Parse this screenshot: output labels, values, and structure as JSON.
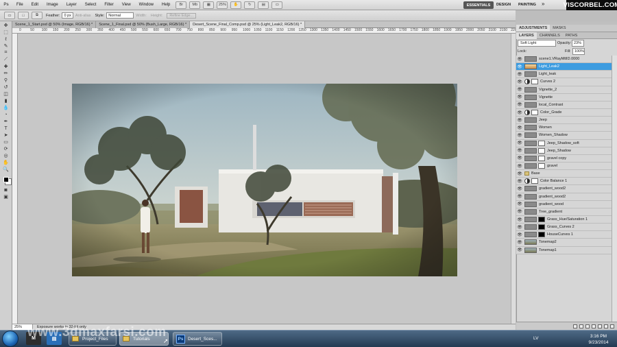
{
  "app": {
    "logo": "Ps"
  },
  "menu": [
    "File",
    "Edit",
    "Image",
    "Layer",
    "Select",
    "Filter",
    "View",
    "Window",
    "Help"
  ],
  "topbar": {
    "zoom": "25%",
    "workspaces": [
      "ESSENTIALS",
      "DESIGN",
      "PAINTING"
    ],
    "more": "»",
    "brand": "VISCORBEL.COM"
  },
  "options": {
    "feather_label": "Feather:",
    "feather_value": "0 px",
    "antialias": "Anti-alias",
    "style_label": "Style:",
    "style_value": "Normal",
    "width_label": "Width:",
    "height_label": "Height:",
    "refine_edge": "Refine Edge..."
  },
  "doc_tabs": [
    "Scene_1_Start.psd @ 50% (Image, RGB/16) *",
    "Scene_1_Final.psd @ 50% (Bush_Large, RGB/16) *",
    "Desert_Scene_Final_Comp.psd @ 25% (Light_Leak2, RGB/16) *"
  ],
  "ruler_labels": [
    "0",
    "50",
    "100",
    "150",
    "200",
    "250",
    "300",
    "350",
    "400",
    "450",
    "500",
    "550",
    "600",
    "650",
    "700",
    "750",
    "800",
    "850",
    "900",
    "950",
    "1000",
    "1050",
    "1100",
    "1150",
    "1200",
    "1250",
    "1300",
    "1350",
    "1400",
    "1450",
    "1500",
    "1550",
    "1600",
    "1650",
    "1700",
    "1750",
    "1800",
    "1850",
    "1900",
    "1950",
    "2000",
    "2050",
    "2100",
    "2150",
    "2200"
  ],
  "status": {
    "zoom": "25%",
    "text": "Exposure works in 32-bit only"
  },
  "panels": {
    "top_tabs": [
      "ADJUSTMENTS",
      "MASKS"
    ],
    "layer_tabs": [
      "LAYERS",
      "CHANNELS",
      "PATHS"
    ],
    "blend_mode": "Soft Light",
    "opacity_label": "Opacity:",
    "opacity": "23%",
    "lock_label": "Lock:",
    "fill_label": "Fill:",
    "fill": "100%"
  },
  "layers": [
    {
      "name": "scene1.VRayMtlID.0000",
      "kind": "image"
    },
    {
      "name": "Light_Leak2",
      "kind": "image",
      "selected": true
    },
    {
      "name": "Light_leak",
      "kind": "image"
    },
    {
      "name": "Curves 2",
      "kind": "adjust"
    },
    {
      "name": "Vignette_2",
      "kind": "image"
    },
    {
      "name": "Vignette",
      "kind": "image"
    },
    {
      "name": "local_Contrast",
      "kind": "image"
    },
    {
      "name": "Color_Grade",
      "kind": "adjust"
    },
    {
      "name": "Jeep",
      "kind": "image"
    },
    {
      "name": "Women",
      "kind": "image"
    },
    {
      "name": "Women_Shadow",
      "kind": "image"
    },
    {
      "name": "Jeep_Shadow_soft",
      "kind": "mask"
    },
    {
      "name": "Jeep_Shadow",
      "kind": "mask"
    },
    {
      "name": "gravel copy",
      "kind": "mask"
    },
    {
      "name": "gravel",
      "kind": "mask"
    },
    {
      "name": "Base",
      "kind": "group"
    },
    {
      "name": "Color Balance 1",
      "kind": "adjust"
    },
    {
      "name": "gradient_wood2",
      "kind": "image"
    },
    {
      "name": "gradient_wood2",
      "kind": "image"
    },
    {
      "name": "gradient_wood",
      "kind": "image"
    },
    {
      "name": "Tree_gradient",
      "kind": "image"
    },
    {
      "name": "Grass_Hue/Saturation 1",
      "kind": "blackmask"
    },
    {
      "name": "Grass_Curves 2",
      "kind": "blackmask"
    },
    {
      "name": "HouseCurves 1",
      "kind": "blackmask"
    },
    {
      "name": "Tonemap2",
      "kind": "photo"
    },
    {
      "name": "Tonemap1",
      "kind": "photo"
    }
  ],
  "taskbar": {
    "buttons": [
      "Project_Files",
      "Tutorials",
      "Desert_Sces..."
    ],
    "lang": "LV",
    "time": "3:16 PM",
    "date": "9/23/2014"
  },
  "watermark": "www.3dmaxfarsi.com",
  "colors": {
    "selection": "#3d9ce0",
    "taskbar": "#2f4a66"
  }
}
